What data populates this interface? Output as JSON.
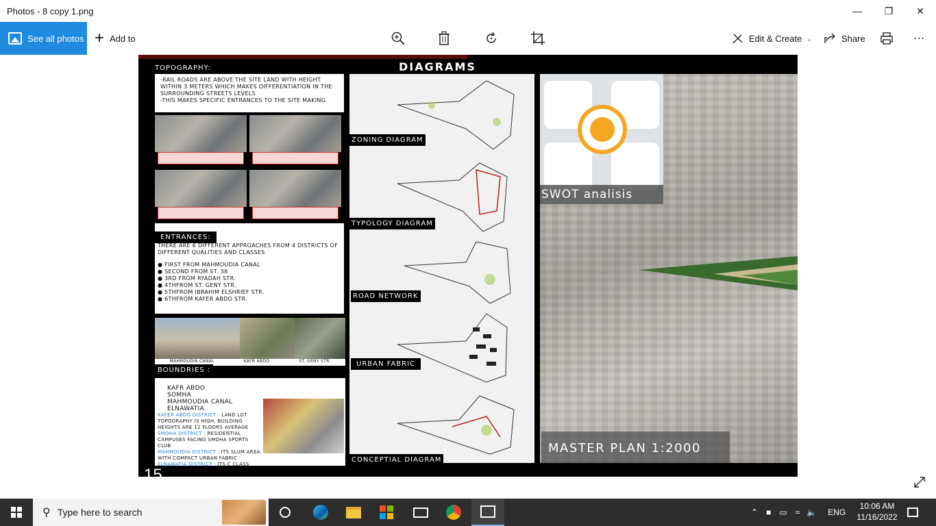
{
  "window": {
    "title": "Photos - 8 copy 1.png",
    "minimize_icon": "minimize-icon",
    "maximize_icon": "restore-icon",
    "close_icon": "close-icon"
  },
  "toolbar": {
    "see_all_label": "See all photos",
    "add_to_label": "Add to",
    "zoom_icon": "zoom-in-icon",
    "delete_icon": "trash-icon",
    "rotate_icon": "rotate-icon",
    "crop_icon": "crop-icon",
    "edit_create_label": "Edit & Create",
    "share_label": "Share",
    "print_icon": "print-icon",
    "more_icon": "more-icon",
    "accent": "#1f8ae0"
  },
  "poster": {
    "header": "DIAGRAMS",
    "topography": {
      "label": "Topography:",
      "text": "-Rail roads are above the site land with height within 3 meters which makes differentiation in the surrounding streets levels\n-This makes specific entrances to the site making"
    },
    "entrances": {
      "label": "Entrances:",
      "intro": "There are 6 different approaches from 4 districts of different qualities and classes",
      "items": [
        "First from mahmoudia canal",
        "Second from st. 38",
        "3rd from ryadah str.",
        "4thfrom st. Geny str.",
        "5thfrom Ibrahim Elshrief str.",
        "6thfrom Kafer Abdo str."
      ],
      "photo_captions": [
        "Mahmoudia canal",
        "Kafr Abdo",
        "St. Geny str."
      ]
    },
    "boundries": {
      "label": "Boundries :",
      "items": [
        "Kafr Abdo",
        "Somha",
        "Mahmoudia Canal",
        "Elnawatia"
      ],
      "districts": [
        {
          "name": "Kafer Abdo district :",
          "text": "Land lot topography is high, building heights are 12 floors average"
        },
        {
          "name": "Smoha district :",
          "text": "Residential campuses facing Smoha sports club"
        },
        {
          "name": "Mahmoudia district :",
          "text": "Its slum area with compact urban fabric"
        },
        {
          "name": "Elnawatia district :",
          "text": "Its C class residential area."
        }
      ]
    },
    "diagrams": [
      "Zoning diagram",
      "Typology diagram",
      "Road network",
      "Urban fabric",
      "Conceptial diagram"
    ],
    "swot_title": "SWOT analisis",
    "master_plan": "MASTER PLAN 1:2000",
    "page_number": "15"
  },
  "taskbar": {
    "search_placeholder": "Type here to search",
    "apps": [
      "task-view-icon",
      "edge-icon",
      "file-explorer-icon",
      "store-icon",
      "mail-icon",
      "chrome-icon",
      "photos-icon"
    ],
    "language": "ENG",
    "time": "10:06 AM",
    "date": "11/16/2022"
  }
}
